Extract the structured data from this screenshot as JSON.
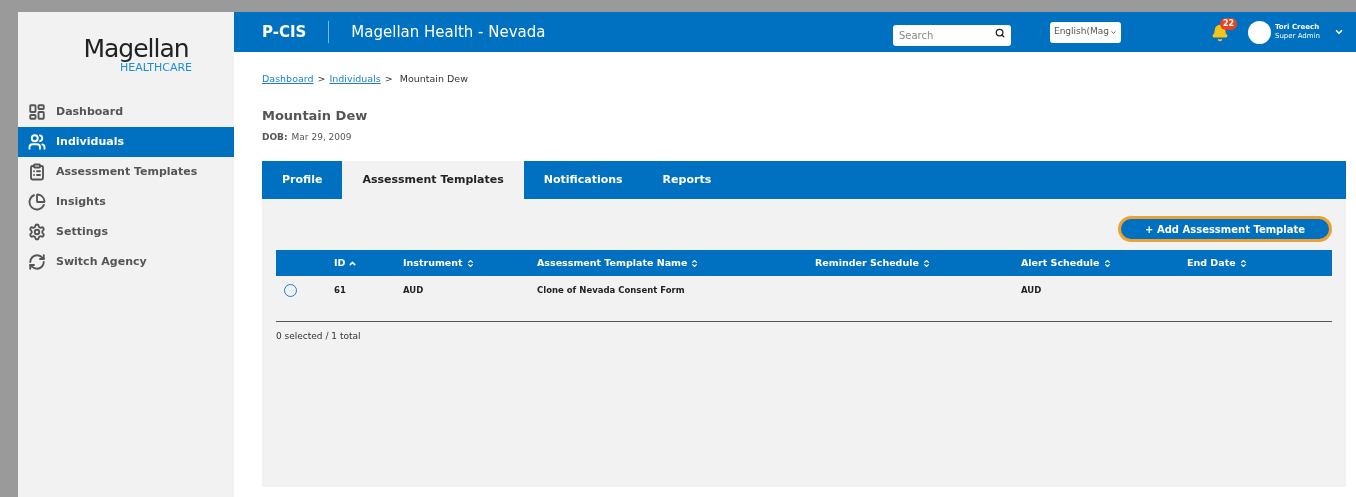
{
  "logo": {
    "name": "Magellan",
    "sub": "HEALTHCARE"
  },
  "sidebar": {
    "items": [
      {
        "label": "Dashboard",
        "selected": false
      },
      {
        "label": "Individuals",
        "selected": true
      },
      {
        "label": "Assessment Templates",
        "selected": false
      },
      {
        "label": "Insights",
        "selected": false
      },
      {
        "label": "Settings",
        "selected": false
      },
      {
        "label": "Switch Agency",
        "selected": false
      }
    ]
  },
  "header": {
    "app": "P-CIS",
    "title": "Magellan Health - Nevada",
    "search": {
      "placeholder": "Search"
    },
    "language": "English(Maɡ",
    "notifications": "22",
    "user": {
      "name": "Tori Creech",
      "role": "Super Admin"
    }
  },
  "breadcrumb": {
    "separator": ">",
    "items": [
      {
        "label": "Dashboard",
        "link": true
      },
      {
        "label": "Individuals",
        "link": true
      },
      {
        "label": "Mountain Dew",
        "link": false
      }
    ]
  },
  "person": {
    "name": "Mountain Dew",
    "dob_label": "DOB:",
    "dob": "Mar 29, 2009"
  },
  "tabs": [
    {
      "label": "Profile",
      "selected": false
    },
    {
      "label": "Assessment Templates",
      "selected": true
    },
    {
      "label": "Notifications",
      "selected": false
    },
    {
      "label": "Reports",
      "selected": false
    }
  ],
  "add_button": "+ Add Assessment Template",
  "table": {
    "columns": [
      {
        "label": "ID",
        "sorted": true
      },
      {
        "label": "Instrument",
        "sorted": false
      },
      {
        "label": "Assessment Template Name",
        "sorted": false
      },
      {
        "label": "Reminder Schedule",
        "sorted": false
      },
      {
        "label": "Alert Schedule",
        "sorted": false
      },
      {
        "label": "End Date",
        "sorted": false
      }
    ],
    "rows": [
      {
        "selected": false,
        "cells": [
          "61",
          "AUD",
          "Clone of Nevada Consent Form",
          "",
          "AUD",
          ""
        ]
      }
    ]
  },
  "footer": "0 selected / 1 total"
}
